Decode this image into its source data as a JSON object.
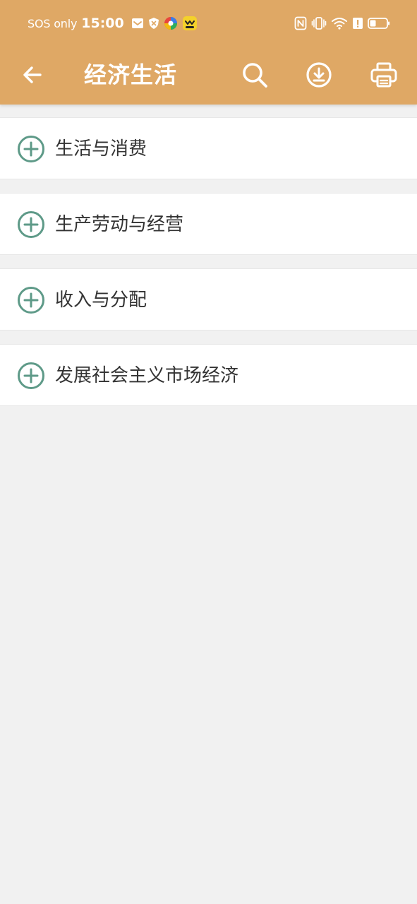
{
  "status_bar": {
    "carrier": "SOS only",
    "time": "15:00",
    "notification_icons": [
      "mail-icon",
      "shield-x-icon",
      "colorful-app-icon",
      "yellow-app-icon"
    ],
    "system_icons": [
      "nfc-icon",
      "vibrate-icon",
      "wifi-icon",
      "alert-icon",
      "battery-icon"
    ]
  },
  "app_bar": {
    "title": "经济生活",
    "icons": [
      "back-arrow-icon",
      "search-icon",
      "download-icon",
      "printer-icon"
    ]
  },
  "list": {
    "items": [
      {
        "label": "生活与消费",
        "icon": "plus-circle-icon"
      },
      {
        "label": "生产劳动与经营",
        "icon": "plus-circle-icon"
      },
      {
        "label": "收入与分配",
        "icon": "plus-circle-icon"
      },
      {
        "label": "发展社会主义市场经济",
        "icon": "plus-circle-icon"
      }
    ]
  },
  "colors": {
    "header": "#dfa865",
    "background": "#f1f1f1",
    "icon_accent": "#5e9a88",
    "text": "#333333"
  }
}
